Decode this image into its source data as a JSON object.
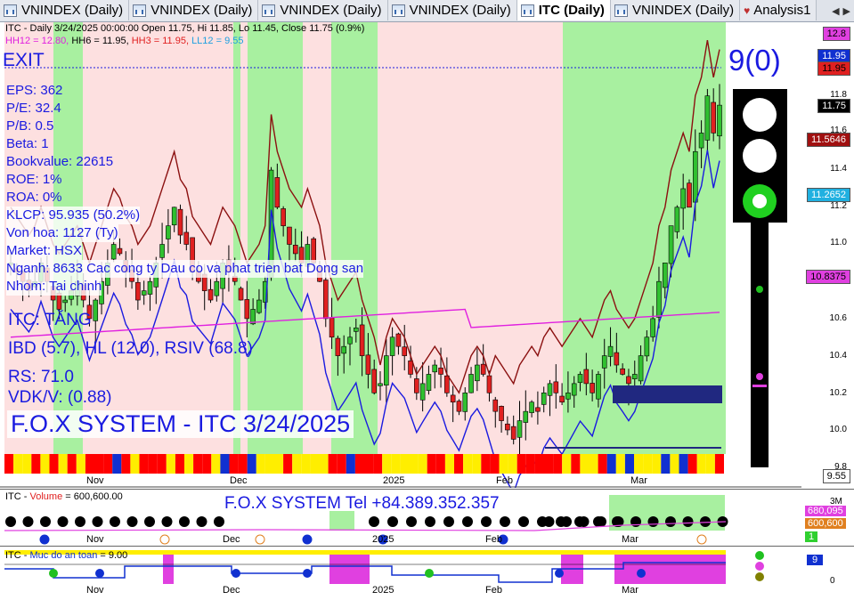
{
  "tabs": [
    {
      "label": "VNINDEX (Daily)",
      "active": false,
      "icon": "chart-icon"
    },
    {
      "label": "VNINDEX (Daily)",
      "active": false,
      "icon": "chart-icon"
    },
    {
      "label": "VNINDEX (Daily)",
      "active": false,
      "icon": "chart-icon"
    },
    {
      "label": "VNINDEX (Daily)",
      "active": false,
      "icon": "chart-icon"
    },
    {
      "label": "ITC (Daily)",
      "active": true,
      "icon": "chart-icon"
    },
    {
      "label": "VNINDEX (Daily)",
      "active": false,
      "icon": "chart-icon"
    },
    {
      "label": "Analysis1",
      "active": false,
      "icon": "analysis-icon"
    }
  ],
  "header": {
    "line1": "ITC - Daily 3/24/2025 00:00:00 Open 11.75, Hi 11.85, Lo 11.45, Close 11.75 (0.9%)",
    "hh12": "HH12 = 12.80,",
    "hh6": "HH6 = 11.95,",
    "hh3": "HH3 = 11.95,",
    "ll12": "LL12 = 9.55"
  },
  "exit_label": "EXIT",
  "score": "9(0)",
  "fundamentals": [
    "EPS: 362",
    "P/E: 32.4",
    "P/B: 0.5",
    "Beta: 1",
    "Bookvalue: 22615",
    "ROE: 1%",
    "ROA: 0%",
    "KLCP: 95.935 (50.2%)",
    "Von hoa: 1127 (Ty)",
    "Market: HSX",
    "Nganh: 8633 Cac cong ty Dau co va phat trien bat Dong san",
    "Nhom: Tai chinh"
  ],
  "status": "ITC: TĂNG",
  "ibd": "IBD (5.7), HL (12.0), RSIV (68.8)",
  "rs": "RS: 71.0",
  "vdk": "VDK/V:  (0.88)",
  "system_title": "F.O.X SYSTEM - ITC 3/24/2025",
  "price_axis": [
    "12.8",
    "11.8",
    "11.6",
    "11.4",
    "11.2",
    "11.0",
    "10.6",
    "10.4",
    "10.2",
    "10.0",
    "9.8"
  ],
  "price_tags": [
    {
      "v": "12.8",
      "color": "#e040e0",
      "fg": "#000"
    },
    {
      "v": "11.95",
      "color": "#1030d0",
      "fg": "#fff"
    },
    {
      "v": "11.95",
      "color": "#e02020",
      "fg": "#000"
    },
    {
      "v": "11.75",
      "color": "#000",
      "fg": "#fff"
    },
    {
      "v": "11.5646",
      "color": "#a01010",
      "fg": "#fff"
    },
    {
      "v": "11.2652",
      "color": "#20b0e0",
      "fg": "#fff"
    },
    {
      "v": "10.8375",
      "color": "#e040e0",
      "fg": "#000"
    },
    {
      "v": "9.55",
      "color": "#fff",
      "fg": "#000"
    }
  ],
  "months": [
    "Nov",
    "Dec",
    "2025",
    "Feb",
    "Mar"
  ],
  "volume_panel": {
    "title_prefix": "ITC - ",
    "title_name": "Volume",
    "title_value": " = 600,600.00",
    "contact": "F.O.X SYSTEM Tel +84.389.352.357",
    "axis": [
      "3M",
      "1"
    ],
    "tags": [
      {
        "v": "680,095",
        "color": "#e040e0"
      },
      {
        "v": "600,600",
        "color": "#e08020"
      }
    ]
  },
  "safety_panel": {
    "title_prefix": "ITC - ",
    "title_name": "Muc do an toan",
    "title_value": " = 9.00",
    "axis": [
      "0"
    ],
    "tag": "9"
  },
  "colors": {
    "bull": "#30c030",
    "bear": "#e02020",
    "pink_zone": "#fde0e0",
    "green_zone": "#a8f0a0"
  }
}
